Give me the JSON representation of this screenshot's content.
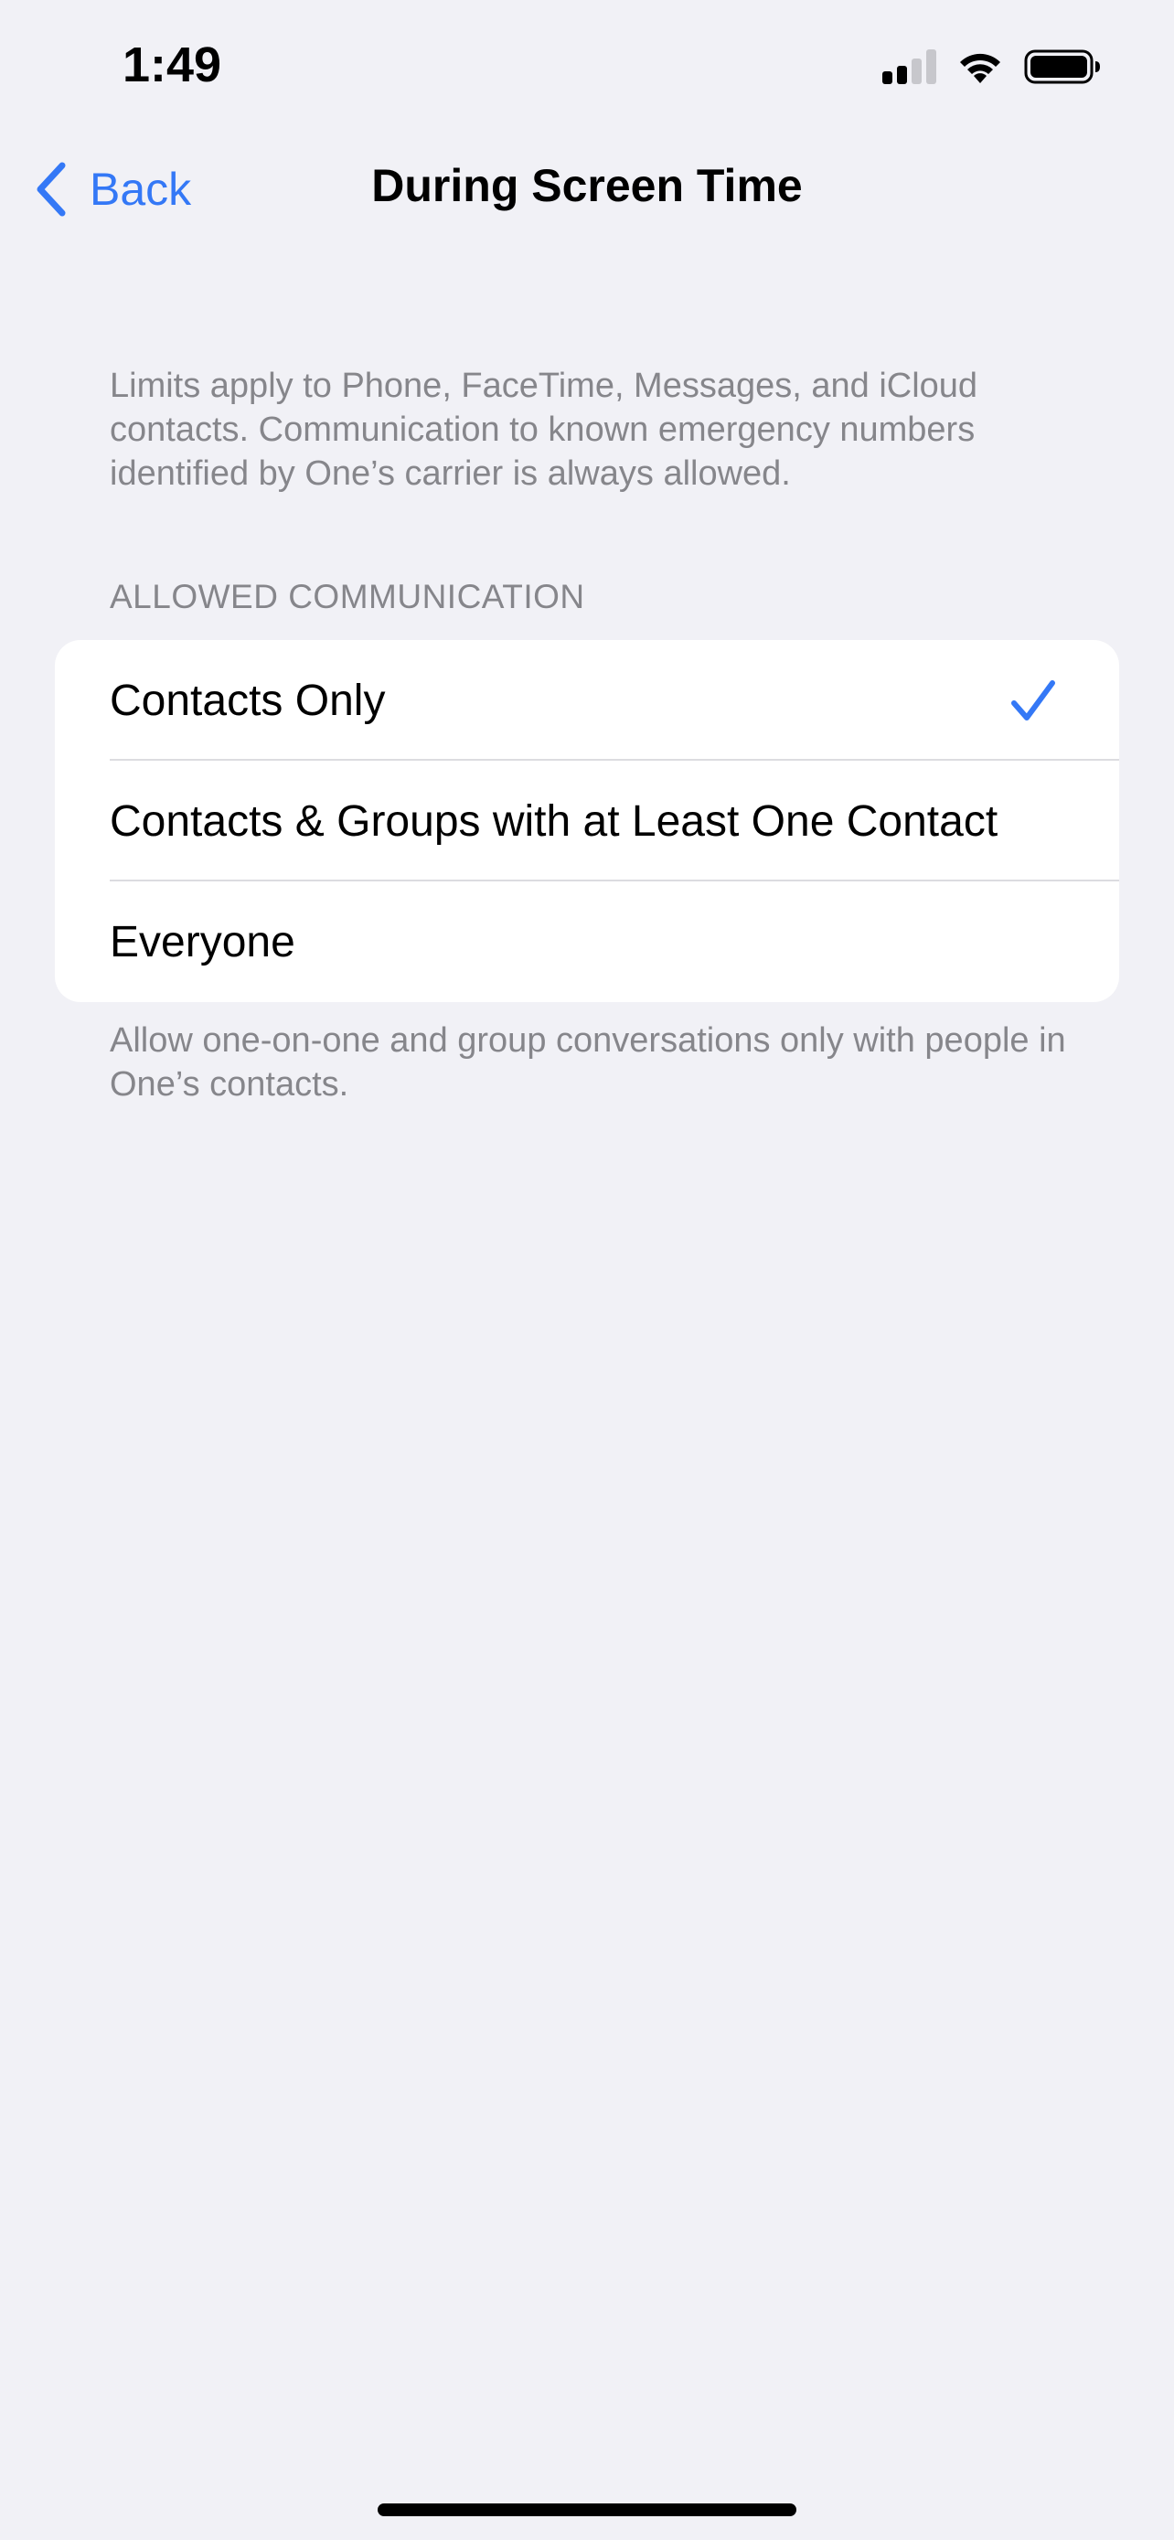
{
  "status_bar": {
    "time": "1:49",
    "icons": [
      "cellular-signal-icon",
      "wifi-icon",
      "battery-icon"
    ]
  },
  "nav": {
    "back_label": "Back",
    "title": "During Screen Time"
  },
  "intro": {
    "text": "Limits apply to Phone, FaceTime, Messages, and iCloud contacts. Communication to known emergency numbers identified by One’s carrier is always allowed."
  },
  "allowed_communication": {
    "header": "ALLOWED COMMUNICATION",
    "options": [
      {
        "label": "Contacts Only",
        "selected": true
      },
      {
        "label": "Contacts & Groups with at Least One Contact",
        "selected": false
      },
      {
        "label": "Everyone",
        "selected": false
      }
    ],
    "footer": "Allow one-on-one and group conversations only with people in One’s contacts."
  },
  "colors": {
    "accent": "#3478f6",
    "background": "#f1f1f6",
    "secondary_text": "#86868b"
  }
}
